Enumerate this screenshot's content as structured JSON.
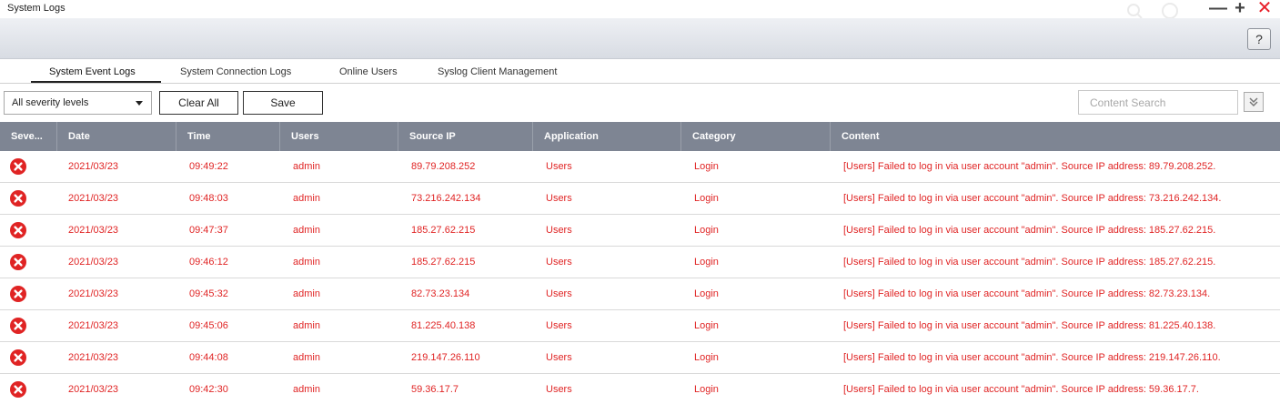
{
  "window": {
    "title": "System Logs"
  },
  "toolbar": {
    "help_label": "?"
  },
  "tabs": [
    {
      "label": "System Event Logs",
      "active": true
    },
    {
      "label": "System Connection Logs",
      "active": false
    },
    {
      "label": "Online Users",
      "active": false
    },
    {
      "label": "Syslog Client Management",
      "active": false
    }
  ],
  "filters": {
    "severity_selected": "All severity levels",
    "clear_label": "Clear All",
    "save_label": "Save",
    "search_placeholder": "Content Search"
  },
  "table": {
    "columns": [
      "Seve...",
      "Date",
      "Time",
      "Users",
      "Source IP",
      "Application",
      "Category",
      "Content"
    ],
    "rows": [
      {
        "severity": "error",
        "date": "2021/03/23",
        "time": "09:49:22",
        "user": "admin",
        "ip": "89.79.208.252",
        "app": "Users",
        "category": "Login",
        "content": "[Users] Failed to log in via user account \"admin\". Source IP address: 89.79.208.252."
      },
      {
        "severity": "error",
        "date": "2021/03/23",
        "time": "09:48:03",
        "user": "admin",
        "ip": "73.216.242.134",
        "app": "Users",
        "category": "Login",
        "content": "[Users] Failed to log in via user account \"admin\". Source IP address: 73.216.242.134."
      },
      {
        "severity": "error",
        "date": "2021/03/23",
        "time": "09:47:37",
        "user": "admin",
        "ip": "185.27.62.215",
        "app": "Users",
        "category": "Login",
        "content": "[Users] Failed to log in via user account \"admin\". Source IP address: 185.27.62.215."
      },
      {
        "severity": "error",
        "date": "2021/03/23",
        "time": "09:46:12",
        "user": "admin",
        "ip": "185.27.62.215",
        "app": "Users",
        "category": "Login",
        "content": "[Users] Failed to log in via user account \"admin\". Source IP address: 185.27.62.215."
      },
      {
        "severity": "error",
        "date": "2021/03/23",
        "time": "09:45:32",
        "user": "admin",
        "ip": "82.73.23.134",
        "app": "Users",
        "category": "Login",
        "content": "[Users] Failed to log in via user account \"admin\". Source IP address: 82.73.23.134."
      },
      {
        "severity": "error",
        "date": "2021/03/23",
        "time": "09:45:06",
        "user": "admin",
        "ip": "81.225.40.138",
        "app": "Users",
        "category": "Login",
        "content": "[Users] Failed to log in via user account \"admin\". Source IP address: 81.225.40.138."
      },
      {
        "severity": "error",
        "date": "2021/03/23",
        "time": "09:44:08",
        "user": "admin",
        "ip": "219.147.26.110",
        "app": "Users",
        "category": "Login",
        "content": "[Users] Failed to log in via user account \"admin\". Source IP address: 219.147.26.110."
      },
      {
        "severity": "error",
        "date": "2021/03/23",
        "time": "09:42:30",
        "user": "admin",
        "ip": "59.36.17.7",
        "app": "Users",
        "category": "Login",
        "content": "[Users] Failed to log in via user account \"admin\". Source IP address: 59.36.17.7."
      }
    ]
  },
  "icons": {
    "minimize": "minimize-icon",
    "maximize": "plus-icon",
    "close": "close-icon",
    "severity_error": "error-circle-icon",
    "advanced_search": "double-chevron-down-icon"
  },
  "colors": {
    "error_text": "#e02424",
    "header_bg": "#7e8593",
    "close": "#e8202a"
  }
}
